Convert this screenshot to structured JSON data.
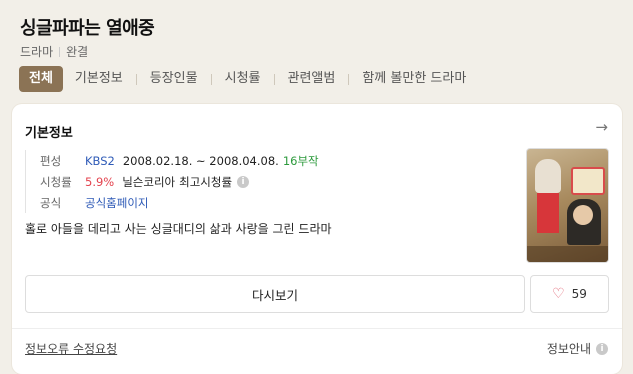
{
  "header": {
    "title": "싱글파파는 열애중",
    "meta": [
      "드라마",
      "완결"
    ]
  },
  "tabs": [
    "전체",
    "기본정보",
    "등장인물",
    "시청률",
    "관련앨범",
    "함께 볼만한 드라마"
  ],
  "card": {
    "title": "기본정보",
    "broadcast": {
      "label": "편성",
      "channel": "KBS2",
      "period": "2008.02.18. ~ 2008.04.08.",
      "episodes": "16부작"
    },
    "rating": {
      "label": "시청률",
      "value": "5.9%",
      "source": "닐슨코리아",
      "type": "최고시청률"
    },
    "official": {
      "label": "공식",
      "link": "공식홈페이지"
    },
    "description": "홀로 아들을 데리고 사는 싱글대디의 삶과 사랑을 그린 드라마",
    "watch_label": "다시보기",
    "like_count": "59",
    "report_label": "정보오류 수정요청",
    "guide_label": "정보안내"
  },
  "colors": {
    "active_tab": "#8b7355",
    "channel": "#2f5bb7",
    "rating": "#e3424d",
    "episodes": "#2c9a3c",
    "heart": "#e06070"
  }
}
